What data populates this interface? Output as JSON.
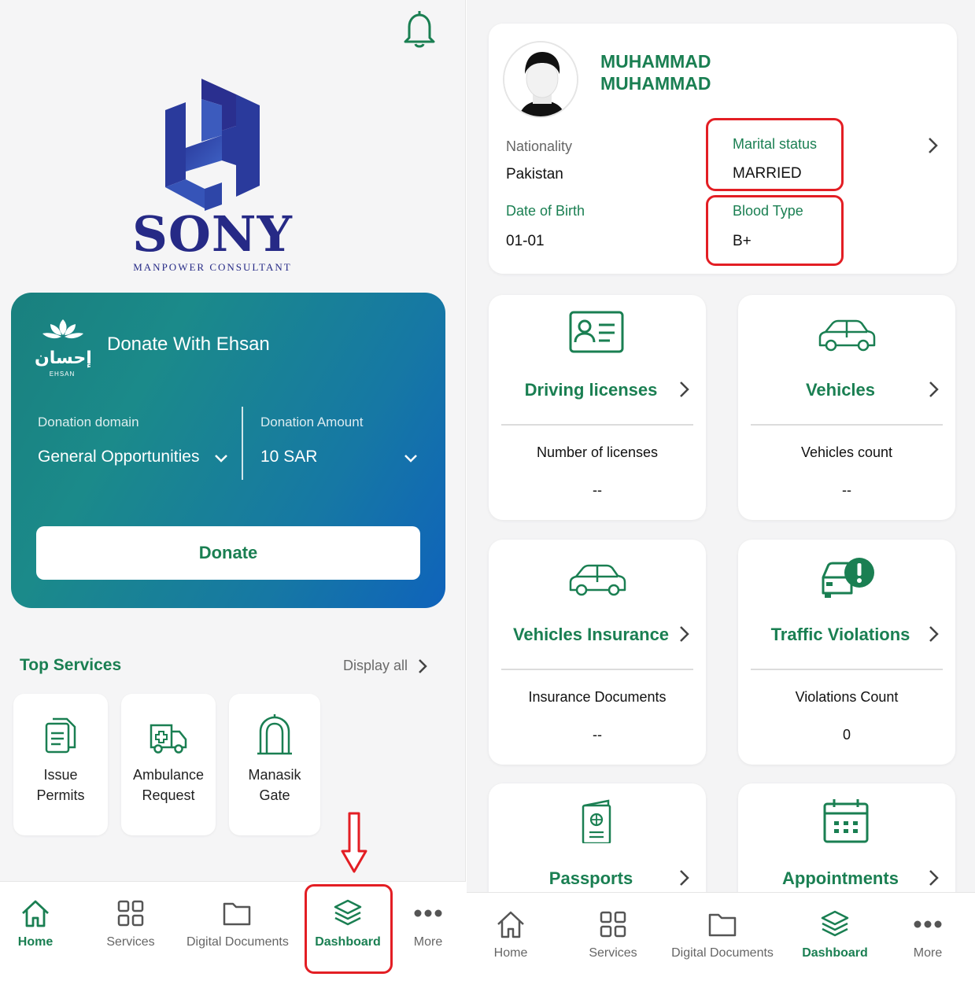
{
  "left": {
    "logo": {
      "word": "SONY",
      "sub": "MANPOWER CONSULTANT"
    },
    "donate": {
      "brand_ar": "إحسان",
      "brand_en": "EHSAN",
      "title": "Donate With Ehsan",
      "domain_label": "Donation domain",
      "domain_value": "General Opportunities",
      "amount_label": "Donation Amount",
      "amount_value": "10 SAR",
      "button": "Donate"
    },
    "top_services": {
      "title": "Top Services",
      "display_all": "Display all",
      "items": [
        {
          "label_1": "Issue",
          "label_2": "Permits",
          "icon": "documents-icon"
        },
        {
          "label_1": "Ambulance",
          "label_2": "Request",
          "icon": "ambulance-icon"
        },
        {
          "label_1": "Manasik",
          "label_2": "Gate",
          "icon": "gate-icon"
        }
      ]
    },
    "nav": {
      "home": "Home",
      "services": "Services",
      "digital_documents": "Digital Documents",
      "dashboard": "Dashboard",
      "more": "More",
      "active": "home"
    }
  },
  "right": {
    "profile": {
      "name_1": "MUHAMMAD",
      "name_2": "MUHAMMAD",
      "nationality_label": "Nationality",
      "nationality_value": "Pakistan",
      "marital_label": "Marital status",
      "marital_value": "MARRIED",
      "dob_label": "Date of Birth",
      "dob_value": "01-01",
      "blood_label": "Blood Type",
      "blood_value": "B+"
    },
    "tiles": [
      {
        "title": "Driving licenses",
        "sub": "Number of licenses",
        "value": "--",
        "icon": "id-card-icon"
      },
      {
        "title": "Vehicles",
        "sub": "Vehicles count",
        "value": "--",
        "icon": "car-icon"
      },
      {
        "title": "Vehicles Insurance",
        "sub": "Insurance Documents",
        "value": "--",
        "icon": "car-insurance-icon"
      },
      {
        "title": "Traffic Violations",
        "sub": "Violations Count",
        "value": "0",
        "icon": "traffic-violation-icon"
      },
      {
        "title": "Passports",
        "icon": "passport-icon"
      },
      {
        "title": "Appointments",
        "icon": "calendar-icon"
      }
    ],
    "nav": {
      "home": "Home",
      "services": "Services",
      "digital_documents": "Digital Documents",
      "dashboard": "Dashboard",
      "more": "More",
      "active": "dashboard"
    }
  },
  "colors": {
    "brand_green": "#1a7f52",
    "logo_blue": "#262a86",
    "highlight_red": "#e31e24"
  }
}
